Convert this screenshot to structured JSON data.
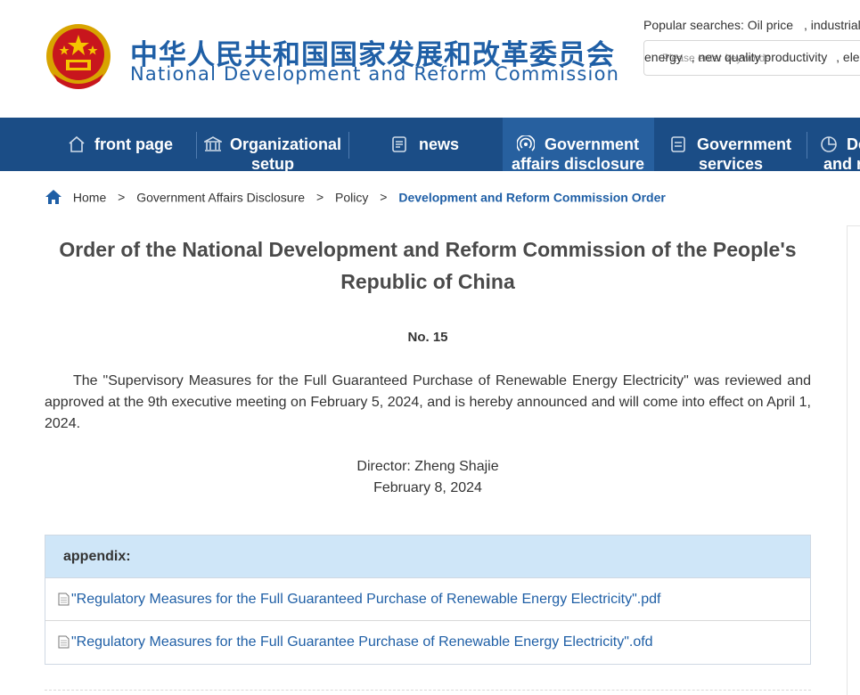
{
  "header": {
    "logo_cn": "中华人民共和国国家发展和改革委员会",
    "logo_en": "National Development and Reform Commission",
    "popular_label": "Popular searches:",
    "popular_keywords": [
      "Oil price",
      ", industrial",
      "energy",
      ", new quality productivity",
      ", ele"
    ],
    "search_placeholder": "Please enter keywords"
  },
  "nav": {
    "items": [
      {
        "label": "front page",
        "icon": "home-outline-icon"
      },
      {
        "label": "Organizational",
        "label2": "setup",
        "icon": "building-icon"
      },
      {
        "label": "news",
        "icon": "newspaper-icon"
      },
      {
        "label": "Government",
        "label2": "affairs disclosure",
        "icon": "broadcast-icon",
        "active": true
      },
      {
        "label": "Government",
        "label2": "services",
        "icon": "document-icon"
      },
      {
        "label": "De",
        "label2": "and r",
        "icon": "pie-chart-icon"
      }
    ]
  },
  "breadcrumb": {
    "items": [
      "Home",
      "Government Affairs Disclosure",
      "Policy"
    ],
    "current": "Development and Reform Commission Order",
    "separator": ">"
  },
  "article": {
    "title": "Order of the National Development and Reform Commission of the People's Republic of China",
    "number": "No. 15",
    "body": "The \"Supervisory Measures for the Full Guaranteed Purchase of Renewable Energy Electricity\" was reviewed and approved at the 9th executive meeting on February 5, 2024, and is hereby announced and will come into effect on April 1, 2024.",
    "director": "Director: Zheng Shajie",
    "date": "February 8, 2024"
  },
  "appendix": {
    "heading": "appendix:",
    "files": [
      "\"Regulatory Measures for the Full Guaranteed Purchase of Renewable Energy Electricity\".pdf",
      "\"Regulatory Measures for the Full Guarantee Purchase of Renewable Energy Electricity\".ofd"
    ]
  },
  "colors": {
    "brand_blue": "#1f5fa6",
    "nav_bg": "#1b4d86",
    "nav_active": "#27609f",
    "appendix_head_bg": "#cfe6f8"
  }
}
